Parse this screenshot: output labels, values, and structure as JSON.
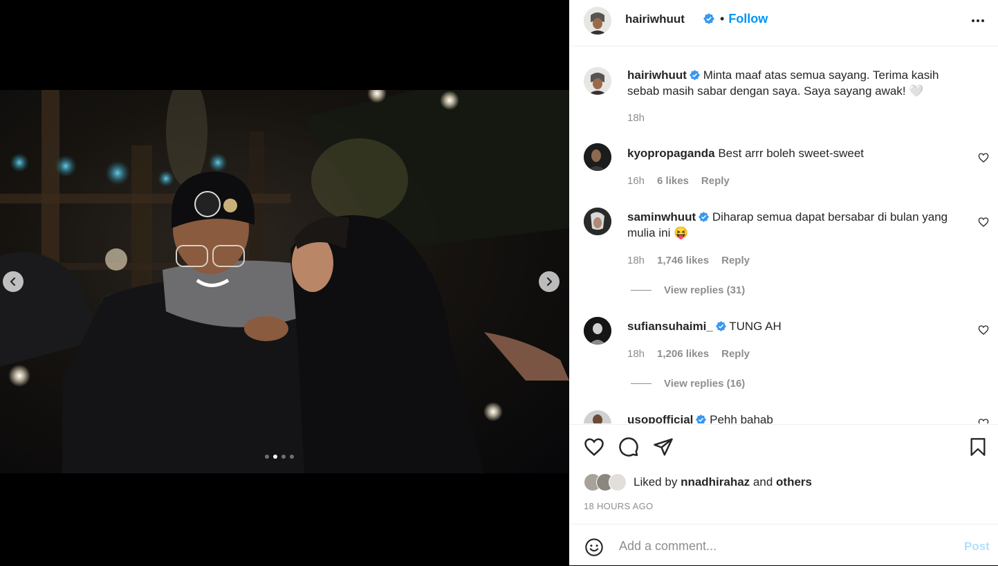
{
  "post": {
    "username": "hairiwhuut",
    "follow_label": "Follow",
    "bullet": "•",
    "caption": "Minta maaf atas semua sayang. Terima kasih sebab masih sabar dengan saya. Saya sayang awak! 🤍",
    "caption_time": "18h"
  },
  "carousel": {
    "slide_count": 4,
    "active_index": 1
  },
  "comments": [
    {
      "username": "kyopropaganda",
      "verified": false,
      "text": "Best arrr boleh sweet-sweet",
      "time": "16h",
      "likes": "6 likes",
      "reply": "Reply"
    },
    {
      "username": "saminwhuut",
      "verified": true,
      "text": "Diharap semua dapat bersabar di bulan yang mulia ini 😝",
      "time": "18h",
      "likes": "1,746 likes",
      "reply": "Reply",
      "view_replies": "View replies (31)"
    },
    {
      "username": "sufiansuhaimi_",
      "verified": true,
      "text": "TUNG AH",
      "time": "18h",
      "likes": "1,206 likes",
      "reply": "Reply",
      "view_replies": "View replies (16)"
    },
    {
      "username": "usopofficial",
      "verified": true,
      "text": "Pehh bahab"
    }
  ],
  "likes": {
    "prefix": "Liked by",
    "user": "nnadhirahaz",
    "and": "and",
    "others": "others"
  },
  "time_ago": "18 HOURS AGO",
  "add_comment": {
    "placeholder": "Add a comment...",
    "post_label": "Post"
  },
  "colors": {
    "accent": "#0095f6",
    "verified": "#3897f0",
    "muted": "#8e8e8e",
    "post_disabled": "#b2dffc"
  },
  "icons": [
    "chevron-left-icon",
    "chevron-right-icon",
    "verified-badge-icon",
    "more-options-icon",
    "heart-icon",
    "comment-icon",
    "share-icon",
    "bookmark-icon",
    "emoji-icon"
  ]
}
